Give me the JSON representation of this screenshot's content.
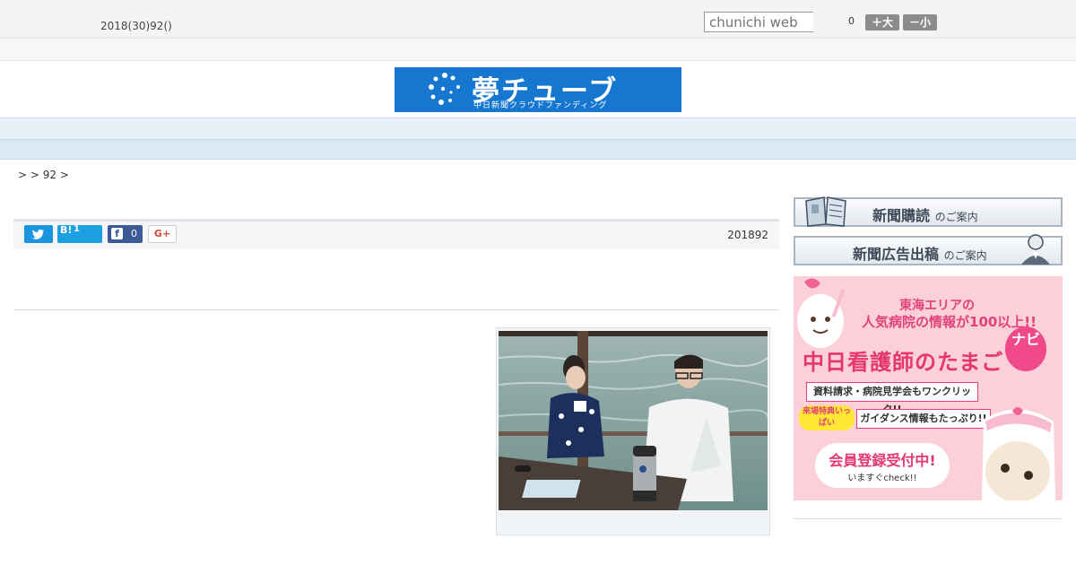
{
  "header": {
    "date_text": "2018(30)92()",
    "search_placeholder": "chunichi web",
    "font_size_count": "0",
    "font_large_label": "＋大",
    "font_small_label": "－小"
  },
  "banner": {
    "logo_main": "夢チューブ",
    "logo_sub": "中日新聞クラウドファンディング"
  },
  "nav": {
    "items": [
      "",
      "",
      "",
      "",
      "",
      "",
      "",
      "",
      ""
    ]
  },
  "breadcrumb": ">  > 92 >",
  "share": {
    "hatena_label": "B!",
    "hatena_count": "1",
    "facebook_letter": "f",
    "facebook_count": "0",
    "gplus_label": "G+",
    "date": "201892"
  },
  "sidebar": {
    "subscribe_main": "新聞購読",
    "subscribe_sub": "のご案内",
    "ad_main": "新聞広告出稿",
    "ad_sub": "のご案内"
  },
  "ad_banner": {
    "line1": "東海エリアの",
    "line2": "人気病院の情報が100以上!!",
    "title": "中日看護師のたまご",
    "navi": "ナビ",
    "feature1": "資料請求・病院見学会もワンクリック!!",
    "badge": "来場特典いっぱい",
    "feature2": "ガイダンス情報もたっぷり!!",
    "cta_main": "会員登録受付中!",
    "cta_sub": "いますぐcheck!!"
  },
  "colors": {
    "brand_blue": "#1677d1",
    "nav_bg": "#e8f1fa",
    "twitter": "#1b95e0",
    "facebook": "#3b5a96",
    "ad_pink": "#e5376f"
  }
}
